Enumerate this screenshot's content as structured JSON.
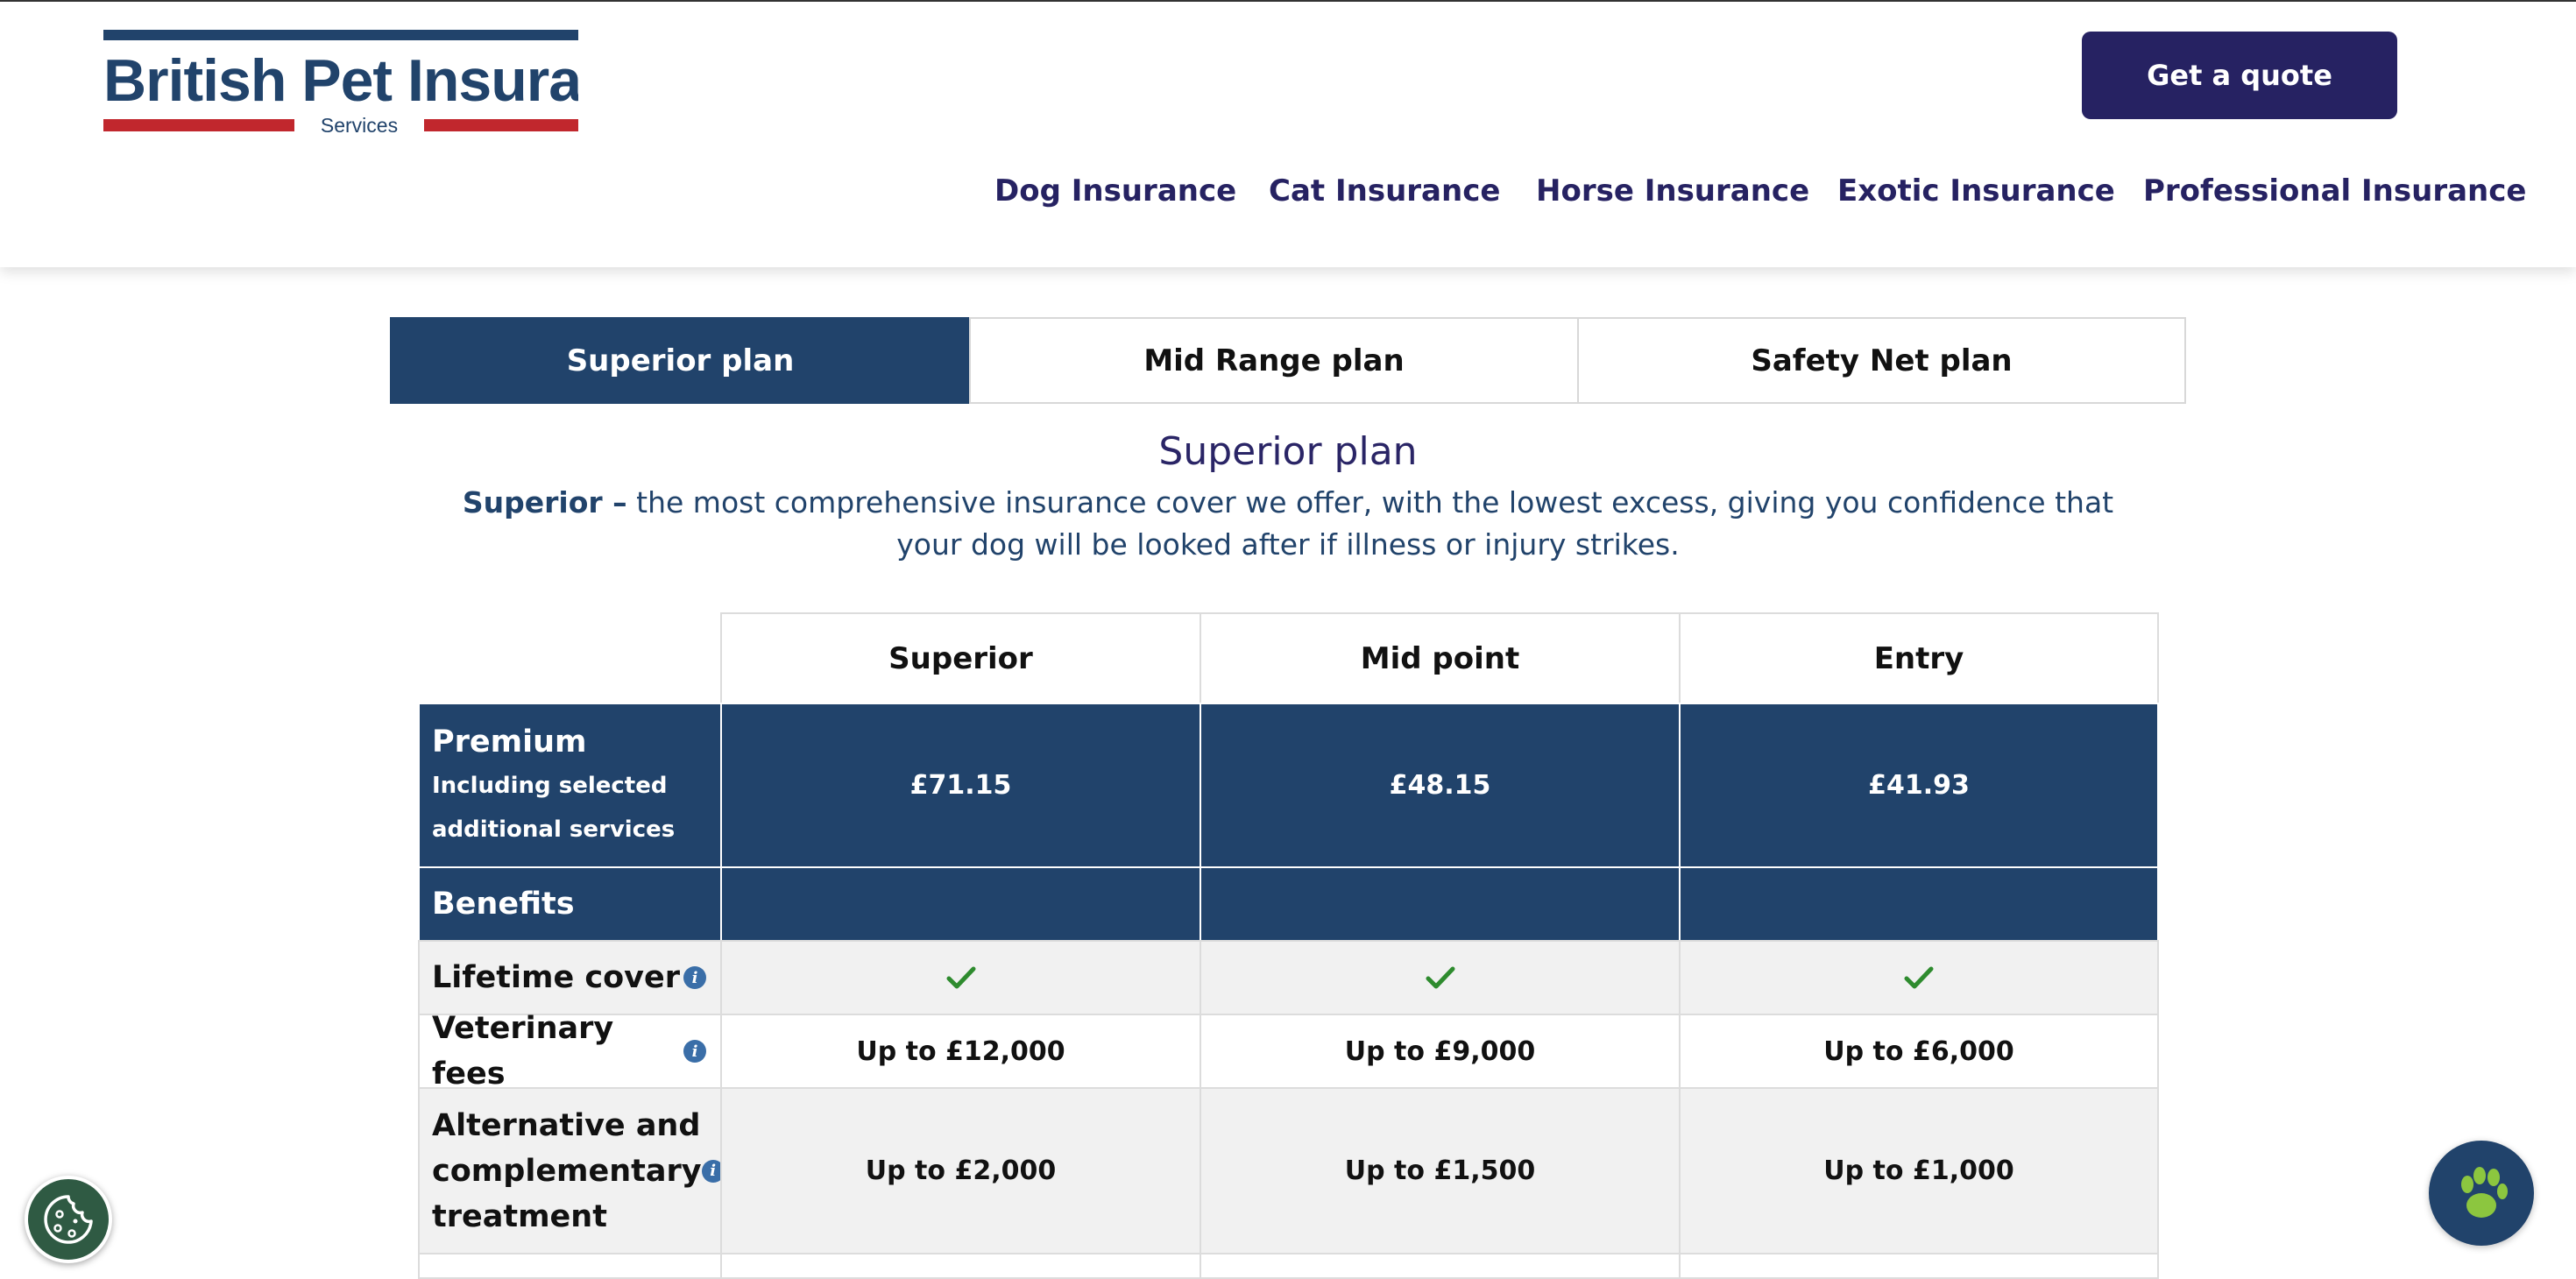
{
  "colors": {
    "navy": "#21436b",
    "brand_dark": "#262262",
    "red": "#c1272d",
    "check_green": "#2e8b2e",
    "paw_green": "#8cc63f",
    "row_grey": "#f1f1f1"
  },
  "logo": {
    "name": "British Pet Insurance",
    "services": "Services"
  },
  "header": {
    "quote_button": "Get a quote",
    "nav": [
      "Dog Insurance",
      "Cat Insurance",
      "Horse Insurance",
      "Exotic Insurance",
      "Professional Insurance"
    ]
  },
  "plan_tabs": {
    "active": "Superior plan",
    "items": [
      "Superior plan",
      "Mid Range plan",
      "Safety Net plan"
    ]
  },
  "plan": {
    "title": "Superior plan",
    "desc_bold": "Superior –",
    "desc_text": " the most comprehensive insurance cover we offer, with the lowest excess, giving you confidence that your dog will be looked after if illness or injury strikes."
  },
  "table": {
    "columns": [
      "Superior",
      "Mid point",
      "Entry"
    ],
    "premium": {
      "label": "Premium",
      "sublabel_line1": "Including selected",
      "sublabel_line2": "additional services",
      "values": [
        "£71.15",
        "£48.15",
        "£41.93"
      ]
    },
    "benefits_label": "Benefits",
    "rows": [
      {
        "label": "Lifetime cover",
        "values": [
          "check-icon",
          "check-icon",
          "check-icon"
        ]
      },
      {
        "label": "Veterinary fees",
        "values": [
          "Up to £12,000",
          "Up to £9,000",
          "Up to £6,000"
        ]
      },
      {
        "label_lines": [
          "Alternative and",
          "complementary",
          "treatment"
        ],
        "values": [
          "Up to £2,000",
          "Up to £1,500",
          "Up to £1,000"
        ]
      }
    ]
  },
  "icons": {
    "info": "info-icon",
    "check": "check-icon",
    "cookie": "cookie-icon",
    "paw": "paw-icon"
  }
}
